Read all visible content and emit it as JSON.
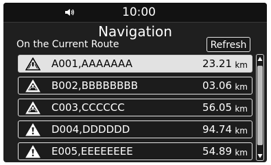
{
  "status": {
    "time": "10:00",
    "icon": "speaker-icon"
  },
  "header": {
    "title": "Navigation",
    "subtitle": "On the Current Route",
    "refresh_label": "Refresh"
  },
  "unit_label": "km",
  "items": [
    {
      "name": "A001,AAAAAAA",
      "distance": "23.21",
      "selected": true,
      "icon": "warning-icon"
    },
    {
      "name": "B002,BBBBBBBB",
      "distance": "03.06",
      "selected": false,
      "icon": "road-warning-icon"
    },
    {
      "name": "C003,CCCCCC",
      "distance": "56.05",
      "selected": false,
      "icon": "road-warning-icon"
    },
    {
      "name": "D004,DDDDDD",
      "distance": "94.74",
      "selected": false,
      "icon": "warning-icon"
    },
    {
      "name": "E005,EEEEEEEE",
      "distance": "54.89",
      "selected": false,
      "icon": "warning-icon"
    }
  ],
  "colors": {
    "background": "#1f1f1f",
    "selected_row": "#e2e2e2",
    "border": "#e6e6e6"
  }
}
